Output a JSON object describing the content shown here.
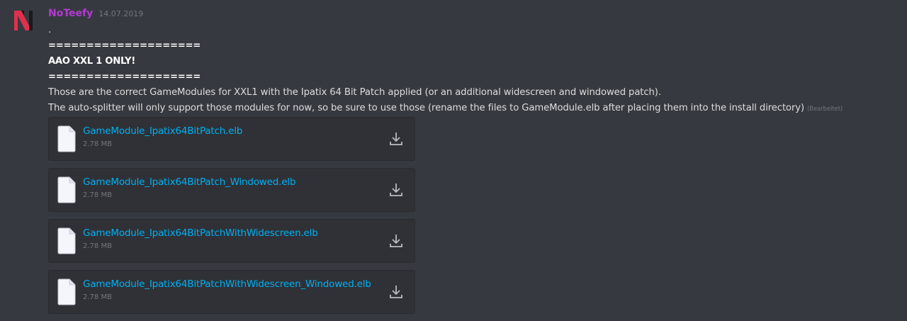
{
  "message": {
    "username": "NoTeefy",
    "timestamp": "14.07.2019",
    "username_color": "#b23bd1",
    "lines": [
      ".",
      "====================",
      "AAO XXL 1 ONLY!",
      "====================",
      "Those are the correct GameModules for XXL1 with the Ipatix 64 Bit Patch applied (or an additional widescreen and windowed patch).",
      "The auto-splitter will only support those modules for now, so be sure to use those (rename the files to GameModule.elb after placing them into the install directory)"
    ],
    "edited_label": "(Bearbeitet)"
  },
  "attachments": [
    {
      "name": "GameModule_Ipatix64BitPatch.elb",
      "size": "2.78 MB",
      "icon": "file-icon",
      "action_icon": "download-icon"
    },
    {
      "name": "GameModule_Ipatix64BitPatch_Windowed.elb",
      "size": "2.78 MB",
      "icon": "file-icon",
      "action_icon": "download-icon"
    },
    {
      "name": "GameModule_Ipatix64BitPatchWithWidescreen.elb",
      "size": "2.78 MB",
      "icon": "file-icon",
      "action_icon": "download-icon"
    },
    {
      "name": "GameModule_Ipatix64BitPatchWithWidescreen_Windowed.elb",
      "size": "2.78 MB",
      "icon": "file-icon",
      "action_icon": "download-icon"
    }
  ],
  "colors": {
    "link": "#00b0f4",
    "background": "#36393f",
    "attachment_bg": "#2f3136"
  }
}
